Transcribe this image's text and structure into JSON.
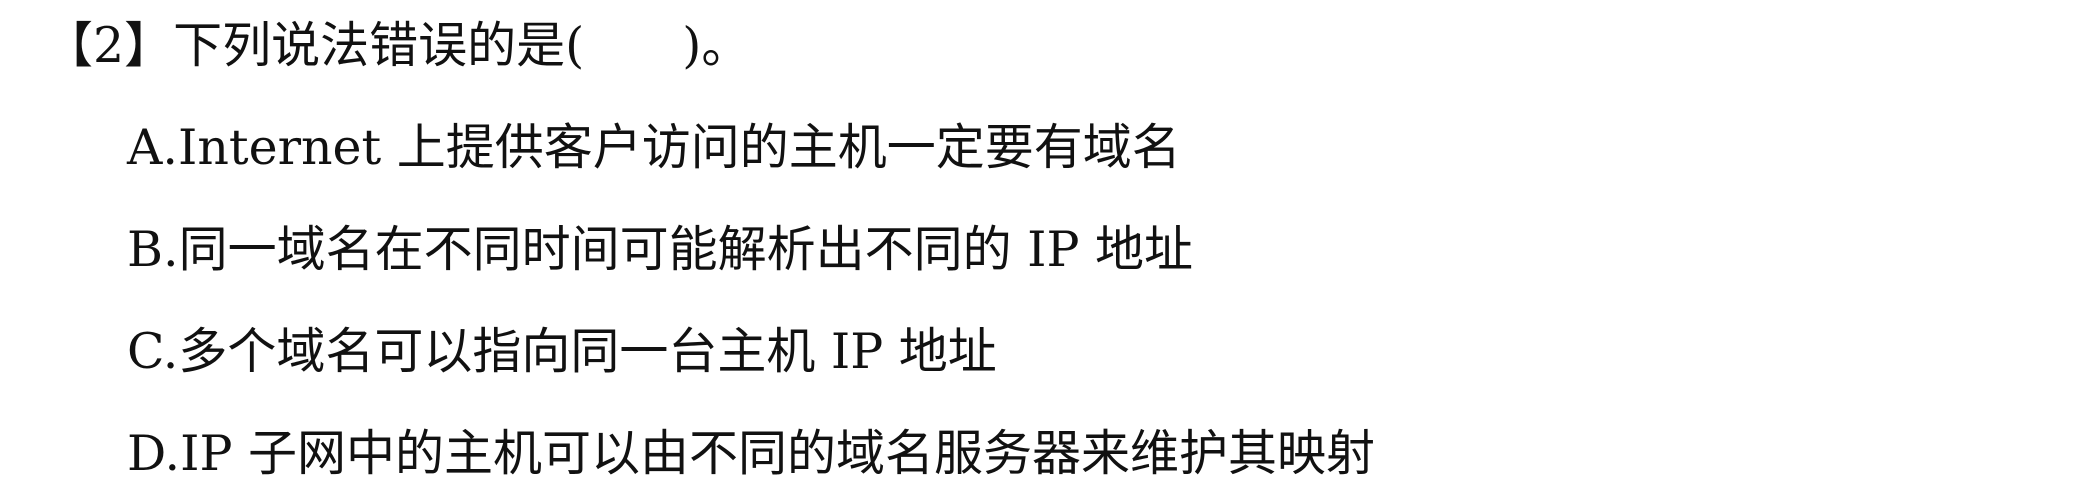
{
  "question": {
    "stem": "【2】下列说法错误的是(　　)。",
    "options": [
      {
        "text": "A.Internet 上提供客户访问的主机一定要有域名"
      },
      {
        "text": "B.同一域名在不同时间可能解析出不同的 IP 地址"
      },
      {
        "text": "C.多个域名可以指向同一台主机 IP 地址"
      },
      {
        "text": "D.IP 子网中的主机可以由不同的域名服务器来维护其映射"
      }
    ]
  }
}
